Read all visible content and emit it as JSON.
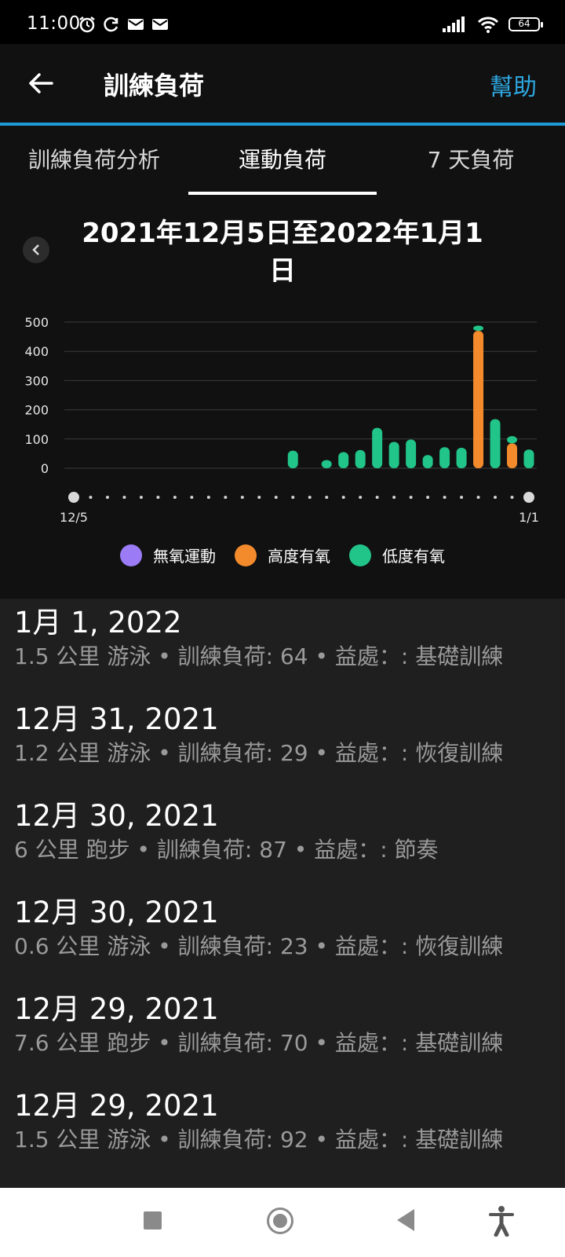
{
  "status_bar": {
    "time": "11:00",
    "battery": "64"
  },
  "app_bar": {
    "title": "訓練負荷",
    "help_label": "幫助"
  },
  "tabs": [
    {
      "label": "訓練負荷分析"
    },
    {
      "label": "運動負荷"
    },
    {
      "label": "7 天負荷"
    }
  ],
  "active_tab": 1,
  "chart": {
    "range_title": "2021年12月5日至2022年1月1日",
    "legend": [
      {
        "label": "無氧運動",
        "color": "#9b7cf6"
      },
      {
        "label": "高度有氧",
        "color": "#f38a2c"
      },
      {
        "label": "低度有氧",
        "color": "#21c489"
      }
    ]
  },
  "chart_data": {
    "type": "bar",
    "stacked": true,
    "x_start_label": "12/5",
    "x_end_label": "1/1",
    "x": [
      "12/5",
      "12/6",
      "12/7",
      "12/8",
      "12/9",
      "12/10",
      "12/11",
      "12/12",
      "12/13",
      "12/14",
      "12/15",
      "12/16",
      "12/17",
      "12/18",
      "12/19",
      "12/20",
      "12/21",
      "12/22",
      "12/23",
      "12/24",
      "12/25",
      "12/26",
      "12/27",
      "12/28",
      "12/29",
      "12/30",
      "12/31",
      "1/1"
    ],
    "y_ticks": [
      0,
      100,
      200,
      300,
      400,
      500
    ],
    "ylim": [
      0,
      500
    ],
    "series": [
      {
        "name": "無氧運動",
        "color": "#9b7cf6",
        "values": [
          0,
          0,
          0,
          0,
          0,
          0,
          0,
          0,
          0,
          0,
          0,
          0,
          0,
          0,
          0,
          0,
          0,
          0,
          0,
          0,
          0,
          0,
          0,
          0,
          0,
          0,
          0,
          0
        ]
      },
      {
        "name": "高度有氧",
        "color": "#f38a2c",
        "values": [
          0,
          0,
          0,
          0,
          0,
          0,
          0,
          0,
          0,
          0,
          0,
          0,
          0,
          0,
          0,
          0,
          0,
          0,
          0,
          0,
          0,
          0,
          0,
          0,
          470,
          0,
          85,
          0
        ]
      },
      {
        "name": "低度有氧",
        "color": "#21c489",
        "values": [
          0,
          0,
          0,
          0,
          0,
          0,
          0,
          0,
          0,
          0,
          0,
          0,
          0,
          60,
          0,
          28,
          55,
          62,
          138,
          90,
          98,
          45,
          72,
          70,
          18,
          168,
          25,
          64
        ]
      }
    ]
  },
  "activities": [
    {
      "date": "1月 1, 2022",
      "detail": "1.5 公里 游泳 • 訓練負荷: 64 • 益處：: 基礎訓練"
    },
    {
      "date": "12月 31, 2021",
      "detail": "1.2 公里 游泳 • 訓練負荷: 29 • 益處：: 恢復訓練"
    },
    {
      "date": "12月 30, 2021",
      "detail": "6 公里 跑步 • 訓練負荷: 87 • 益處：: 節奏"
    },
    {
      "date": "12月 30, 2021",
      "detail": "0.6 公里 游泳 • 訓練負荷: 23 • 益處：: 恢復訓練"
    },
    {
      "date": "12月 29, 2021",
      "detail": "7.6 公里 跑步 • 訓練負荷: 70 • 益處：: 基礎訓練"
    },
    {
      "date": "12月 29, 2021",
      "detail": "1.5 公里 游泳 • 訓練負荷: 92 • 益處：: 基礎訓練"
    }
  ]
}
